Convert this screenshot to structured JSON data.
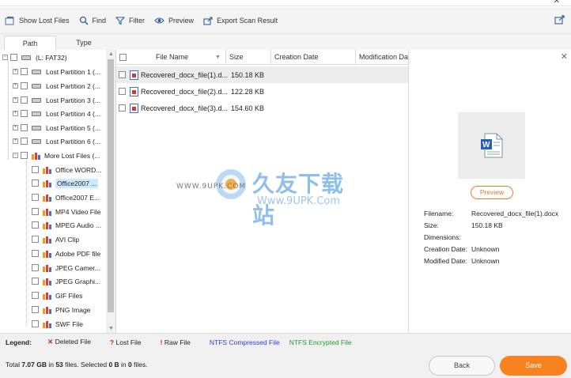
{
  "toolbar": {
    "show_lost_files": "Show Lost Files",
    "find": "Find",
    "filter": "Filter",
    "preview": "Preview",
    "export_scan_result": "Export Scan Result"
  },
  "tabs": [
    "Path",
    "Type"
  ],
  "tree": {
    "root": "(L: FAT32)",
    "partitions": [
      "Lost Partition 1 (...",
      "Lost Partition 2 (...",
      "Lost Partition 3 (...",
      "Lost Partition 4 (...",
      "Lost Partition 5 (...",
      "Lost Partition 6 (..."
    ],
    "more_lost_files": "More Lost Files (...",
    "file_types": [
      "Office WORD...",
      "Office2007 ...",
      "Office2007 E...",
      "MP4 Video File",
      "MPEG Audio ...",
      "AVI Clip",
      "Adobe PDF file",
      "JPEG Camer...",
      "JPEG Graphi...",
      "GIF Files",
      "PNG Image",
      "SWF File"
    ],
    "selected_index": 1
  },
  "file_list": {
    "columns": [
      "File Name",
      "Size",
      "Creation Date",
      "Modification Da"
    ],
    "rows": [
      {
        "name": "Recovered_docx_file(1).d...",
        "size": "150.18 KB"
      },
      {
        "name": "Recovered_docx_file(2).d...",
        "size": "122.28 KB"
      },
      {
        "name": "Recovered_docx_file(3).d...",
        "size": "154.60 KB"
      }
    ]
  },
  "preview_panel": {
    "button": "Preview",
    "fields": [
      {
        "key": "Filename:",
        "value": "Recovered_docx_file(1).docx"
      },
      {
        "key": "Size:",
        "value": "150.18 KB"
      },
      {
        "key": "Dimensions:",
        "value": ""
      },
      {
        "key": "Creation Date:",
        "value": "Unknown"
      },
      {
        "key": "Modified Date:",
        "value": "Unknown"
      }
    ]
  },
  "watermark": {
    "cn": "久友下载站",
    "url_small": "WWW.9UPK.COM",
    "url_large": "Www.9UPK.Com"
  },
  "legend": {
    "title": "Legend:",
    "deleted": "Deleted File",
    "lost": "Lost File",
    "raw": "Raw File",
    "ntfs_compressed": "NTFS Compressed File",
    "ntfs_encrypted": "NTFS Encrypted File"
  },
  "status": {
    "total_prefix": "Total ",
    "total_size": "7.07 GB",
    "in_text": " in ",
    "total_files": "53",
    "files_selected_text": " files.  Selected ",
    "selected_size": "0 B",
    "in_text2": " in ",
    "selected_files": "0",
    "files_end": " files."
  },
  "buttons": {
    "back": "Back",
    "save": "Save"
  },
  "colors": {
    "accent_orange": "#f7821f",
    "legend_red": "#d62020",
    "ntfs_compressed": "#2a3fd6",
    "ntfs_encrypted": "#1f9a2a"
  }
}
